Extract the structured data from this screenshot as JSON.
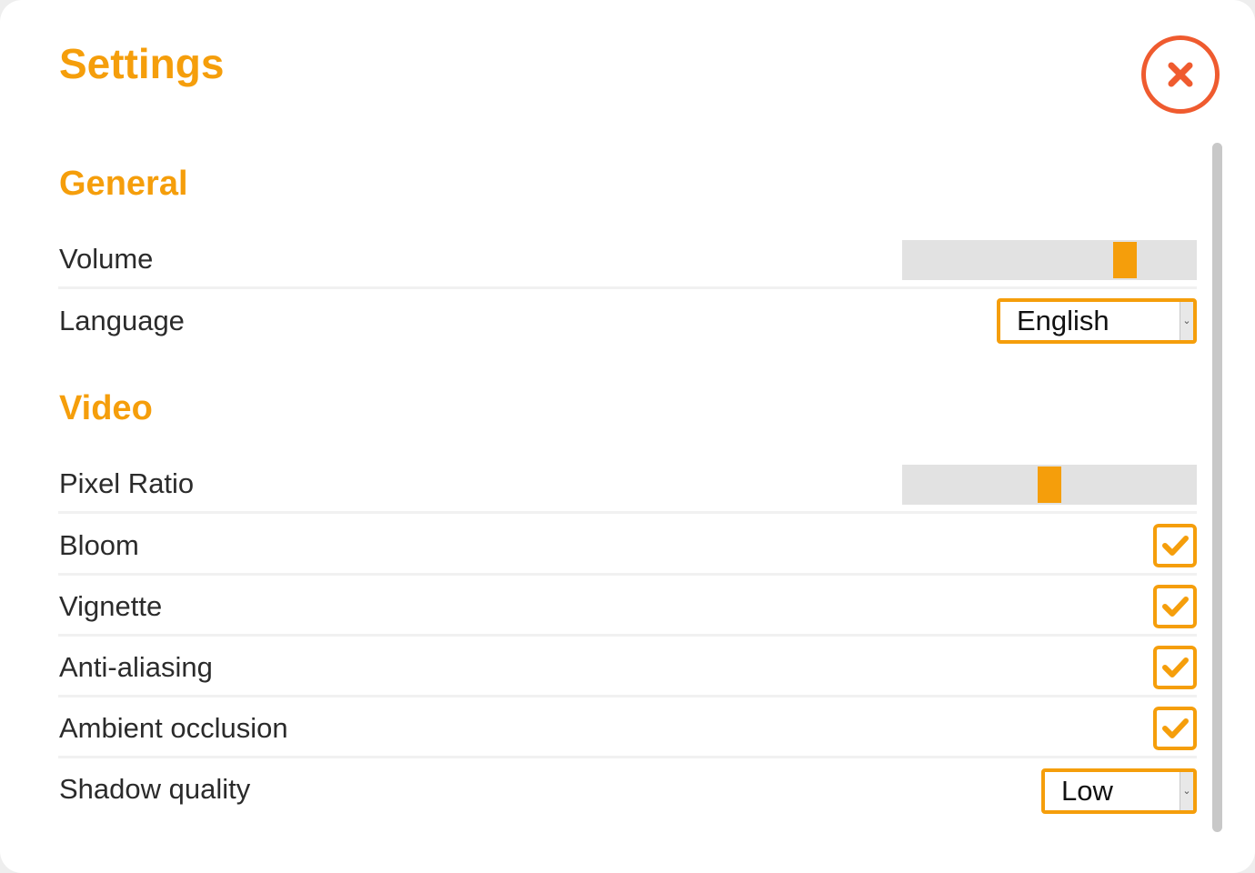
{
  "title": "Settings",
  "colors": {
    "accent": "#f59e0b",
    "close": "#ef5b2f",
    "track": "#e2e2e2",
    "text": "#2b2b2b"
  },
  "close_button": {
    "icon": "close-icon"
  },
  "sections": [
    {
      "title": "General",
      "settings": [
        {
          "label": "Volume",
          "control": "slider",
          "value_fraction": 0.78
        },
        {
          "label": "Language",
          "control": "select",
          "value": "English"
        }
      ]
    },
    {
      "title": "Video",
      "settings": [
        {
          "label": "Pixel Ratio",
          "control": "slider",
          "value_fraction": 0.5
        },
        {
          "label": "Bloom",
          "control": "checkbox",
          "checked": true
        },
        {
          "label": "Vignette",
          "control": "checkbox",
          "checked": true
        },
        {
          "label": "Anti-aliasing",
          "control": "checkbox",
          "checked": true
        },
        {
          "label": "Ambient occlusion",
          "control": "checkbox",
          "checked": true
        },
        {
          "label": "Shadow quality",
          "control": "select",
          "value": "Low"
        }
      ]
    }
  ]
}
